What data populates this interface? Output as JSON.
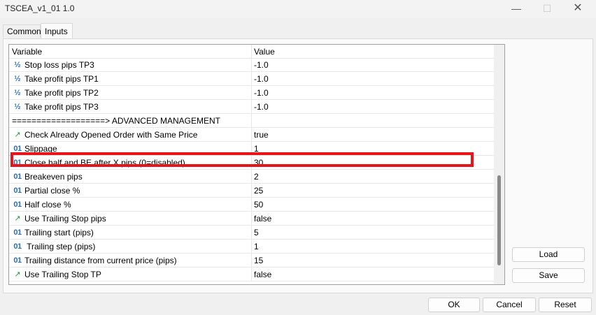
{
  "window": {
    "title": "TSCEA_v1_01 1.0",
    "min_glyph": "—",
    "max_glyph": "☐",
    "close_glyph": "✕"
  },
  "tabs": [
    {
      "label": "Common",
      "selected": false
    },
    {
      "label": "Inputs",
      "selected": true
    }
  ],
  "grid": {
    "columns": [
      "Variable",
      "Value"
    ],
    "rows": [
      {
        "icon": "half-icon",
        "glyph": "½",
        "name": "Stop loss pips TP3",
        "value": "-1.0"
      },
      {
        "icon": "half-icon",
        "glyph": "½",
        "name": "Take profit pips TP1",
        "value": "-1.0"
      },
      {
        "icon": "half-icon",
        "glyph": "½",
        "name": "Take profit pips TP2",
        "value": "-1.0"
      },
      {
        "icon": "half-icon",
        "glyph": "½",
        "name": "Take profit pips TP3",
        "value": "-1.0"
      },
      {
        "icon": "",
        "glyph": "",
        "name": "===================> ADVANCED MANAGEMENT",
        "value": ""
      },
      {
        "icon": "bool-icon",
        "glyph": "↗",
        "name": "Check Already Opened Order with Same Price",
        "value": "true"
      },
      {
        "icon": "integer-icon",
        "glyph": "01",
        "name": "Slippage",
        "value": "1"
      },
      {
        "icon": "integer-icon",
        "glyph": "01",
        "name": "Close half and BE after X pips (0=disabled)",
        "value": "30"
      },
      {
        "icon": "integer-icon",
        "glyph": "01",
        "name": "Breakeven pips",
        "value": "2"
      },
      {
        "icon": "integer-icon",
        "glyph": "01",
        "name": "Partial close %",
        "value": "25"
      },
      {
        "icon": "integer-icon",
        "glyph": "01",
        "name": "Half close %",
        "value": "50"
      },
      {
        "icon": "bool-icon",
        "glyph": "↗",
        "name": "Use Trailing Stop pips",
        "value": "false"
      },
      {
        "icon": "integer-icon",
        "glyph": "01",
        "name": "Trailing start (pips)",
        "value": "5"
      },
      {
        "icon": "integer-icon",
        "glyph": "01",
        "name": " Trailing step (pips)",
        "value": "1"
      },
      {
        "icon": "integer-icon",
        "glyph": "01",
        "name": "Trailing distance from current price (pips)",
        "value": "15"
      },
      {
        "icon": "bool-icon",
        "glyph": "↗",
        "name": "Use Trailing Stop TP",
        "value": "false"
      }
    ]
  },
  "highlight_color": "#e8141b",
  "side_buttons": {
    "load": "Load",
    "save": "Save"
  },
  "footer_buttons": {
    "ok": "OK",
    "cancel": "Cancel",
    "reset": "Reset"
  }
}
